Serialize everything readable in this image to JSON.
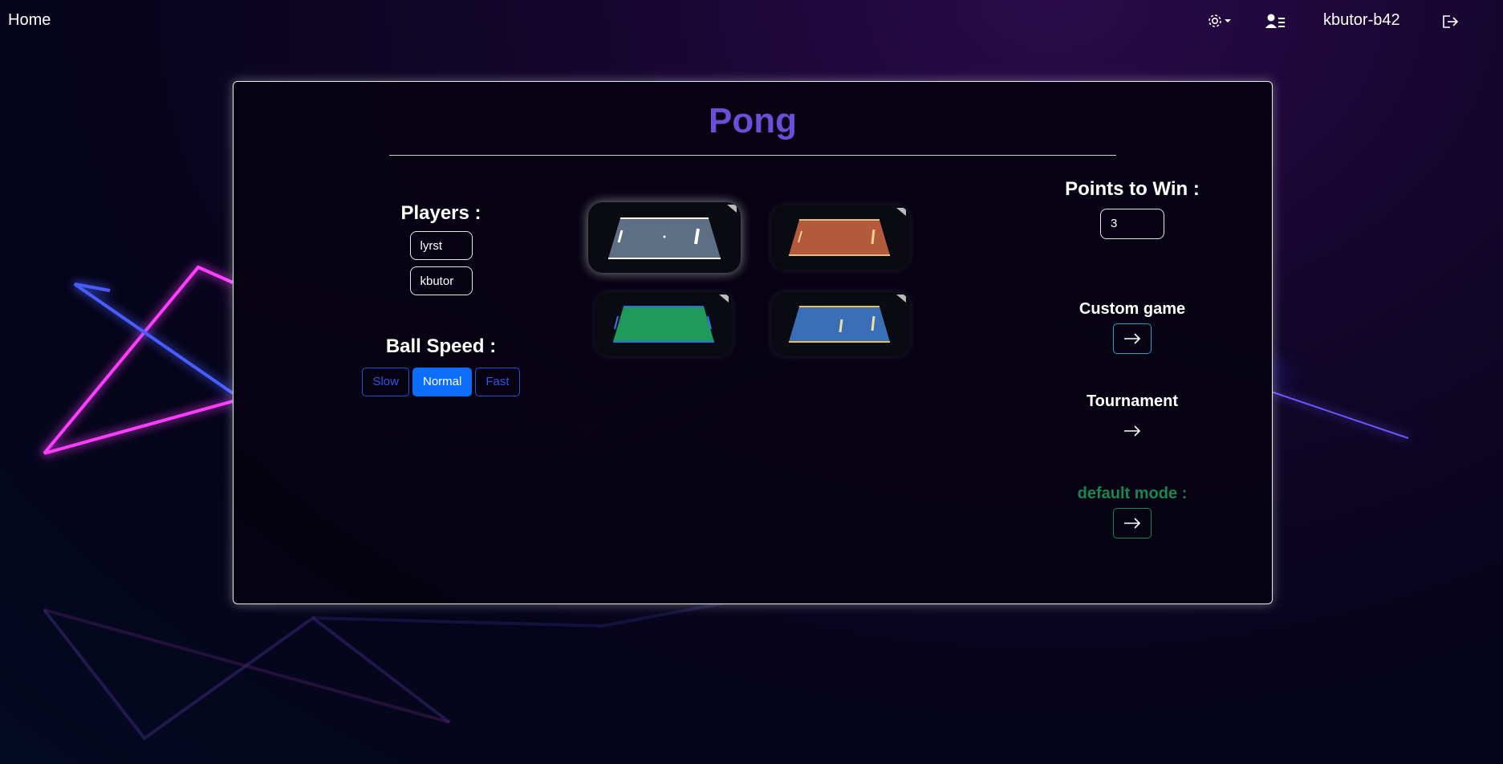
{
  "nav": {
    "home": "Home",
    "username": "kbutor-b42",
    "icons": [
      "gear-icon",
      "caret-down-icon",
      "user-list-icon",
      "logout-icon"
    ]
  },
  "game": {
    "title": "Pong",
    "players_label": "Players :",
    "players": [
      "lyrst",
      "kbutor"
    ],
    "ball_speed_label": "Ball Speed :",
    "speeds": [
      "Slow",
      "Normal",
      "Fast"
    ],
    "selected_speed": "Normal",
    "maps": [
      "white",
      "orange",
      "green",
      "blue"
    ],
    "selected_map": "white",
    "points_label": "Points to Win :",
    "points_value": "3",
    "custom_game_label": "Custom game",
    "tournament_label": "Tournament",
    "default_mode_label": "default mode :"
  },
  "colors": {
    "title": "#6b4fd8",
    "active_button": "#0d6efd",
    "default_mode": "#198754",
    "custom_border": "#1aa7c6"
  }
}
